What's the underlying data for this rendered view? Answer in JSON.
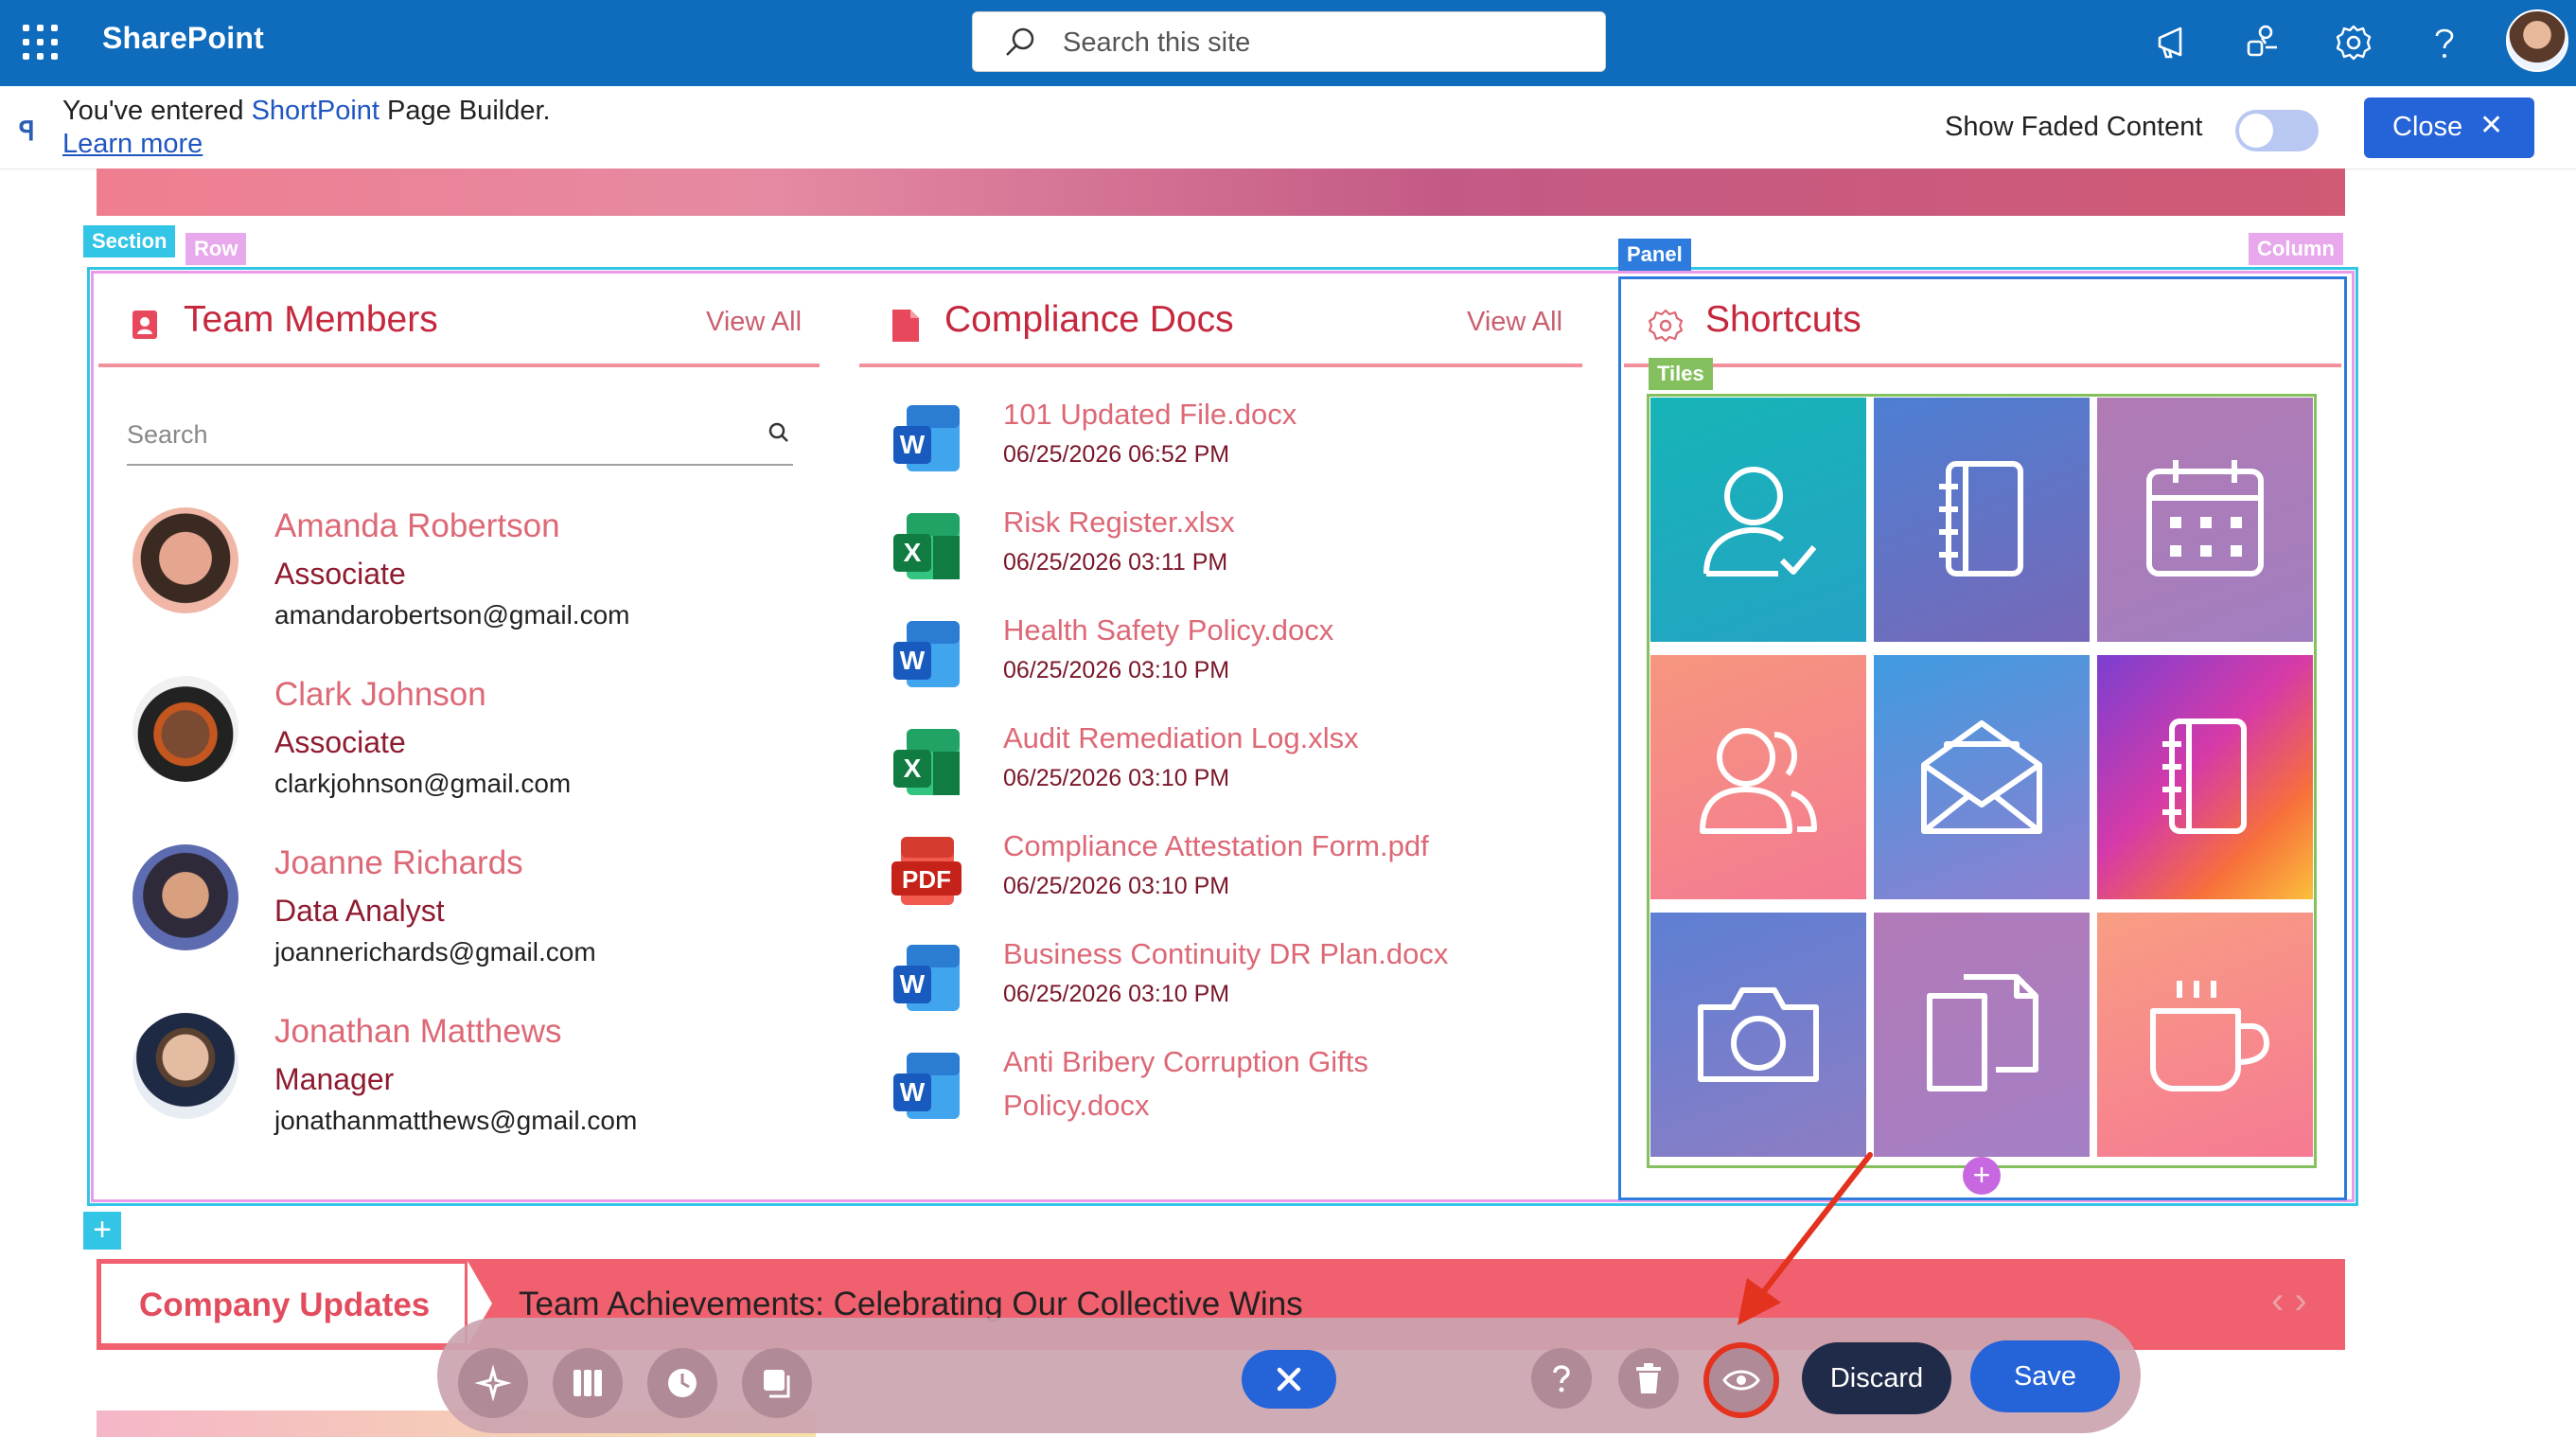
{
  "app": {
    "name": "SharePoint"
  },
  "search": {
    "placeholder": "Search this site"
  },
  "notice": {
    "prefix": "You've entered ",
    "product": "ShortPoint",
    "suffix": " Page Builder.",
    "learn_more": "Learn more",
    "faded_label": "Show Faded Content",
    "faded_on": false,
    "close_label": "Close"
  },
  "editor_tags": {
    "section": "Section",
    "row": "Row",
    "panel": "Panel",
    "column": "Column",
    "tiles": "Tiles"
  },
  "team_members": {
    "title": "Team Members",
    "view_all": "View All",
    "search_placeholder": "Search",
    "people": [
      {
        "name": "Amanda Robertson",
        "role": "Associate",
        "email": "amandarobertson@gmail.com"
      },
      {
        "name": "Clark Johnson",
        "role": "Associate",
        "email": "clarkjohnson@gmail.com"
      },
      {
        "name": "Joanne Richards",
        "role": "Data Analyst",
        "email": "joannerichards@gmail.com"
      },
      {
        "name": "Jonathan Matthews",
        "role": "Manager",
        "email": "jonathanmatthews@gmail.com"
      }
    ]
  },
  "compliance_docs": {
    "title": "Compliance Docs",
    "view_all": "View All",
    "docs": [
      {
        "name": "101 Updated File.docx",
        "date": "06/25/2026 06:52 PM",
        "type": "word"
      },
      {
        "name": "Risk Register.xlsx",
        "date": "06/25/2026 03:11 PM",
        "type": "excel"
      },
      {
        "name": "Health Safety Policy.docx",
        "date": "06/25/2026 03:10 PM",
        "type": "word"
      },
      {
        "name": "Audit Remediation Log.xlsx",
        "date": "06/25/2026 03:10 PM",
        "type": "excel"
      },
      {
        "name": "Compliance Attestation Form.pdf",
        "date": "06/25/2026 03:10 PM",
        "type": "pdf"
      },
      {
        "name": "Business Continuity DR Plan.docx",
        "date": "06/25/2026 03:10 PM",
        "type": "word"
      },
      {
        "name": "Anti Bribery Corruption Gifts",
        "name2": "Policy.docx",
        "type": "word"
      }
    ],
    "pdf_label": "PDF",
    "word_letter": "W",
    "excel_letter": "X"
  },
  "shortcuts": {
    "title": "Shortcuts",
    "tiles": [
      {
        "icon": "user-check-icon"
      },
      {
        "icon": "notebook-icon"
      },
      {
        "icon": "calendar-icon"
      },
      {
        "icon": "users-icon"
      },
      {
        "icon": "envelope-open-icon"
      },
      {
        "icon": "notebook-icon"
      },
      {
        "icon": "camera-icon"
      },
      {
        "icon": "documents-icon"
      },
      {
        "icon": "coffee-cup-icon"
      }
    ]
  },
  "company_updates": {
    "label": "Company Updates",
    "headline": "Team Achievements: Celebrating Our Collective Wins"
  },
  "toolbar": {
    "discard_label": "Discard",
    "save_label": "Save"
  },
  "colors": {
    "brand_blue": "#0f6cbd",
    "accent_red": "#c5283d",
    "pink_accent": "#dd6876",
    "highlight_ring": "#e3321e"
  }
}
